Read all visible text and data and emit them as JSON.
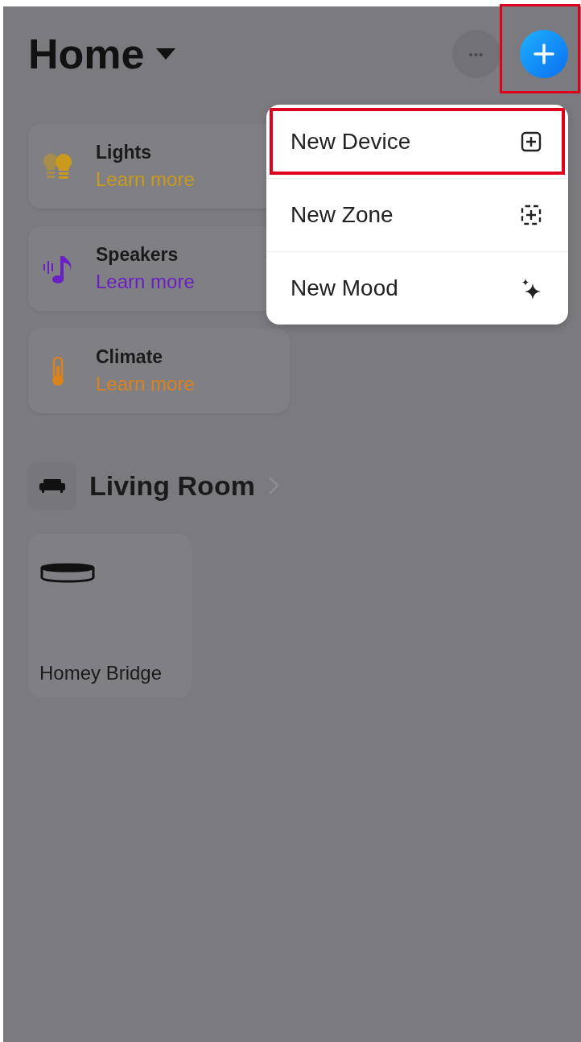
{
  "header": {
    "title": "Home",
    "more_button": {
      "label": "•••"
    },
    "add_button": {
      "highlighted": true
    }
  },
  "categories": [
    {
      "kind": "lights",
      "title": "Lights",
      "link": "Learn more",
      "color": "#c99a1c"
    },
    {
      "kind": "speakers",
      "title": "Speakers",
      "link": "Learn more",
      "color": "#6a1fc4"
    },
    {
      "kind": "climate",
      "title": "Climate",
      "link": "Learn more",
      "color": "#d9821e"
    }
  ],
  "zone": {
    "title": "Living Room",
    "devices": [
      {
        "name": "Homey Bridge"
      }
    ]
  },
  "menu": {
    "items": [
      {
        "kind": "device",
        "label": "New Device",
        "highlighted": true
      },
      {
        "kind": "zone",
        "label": "New Zone",
        "highlighted": false
      },
      {
        "kind": "mood",
        "label": "New Mood",
        "highlighted": false
      }
    ]
  }
}
